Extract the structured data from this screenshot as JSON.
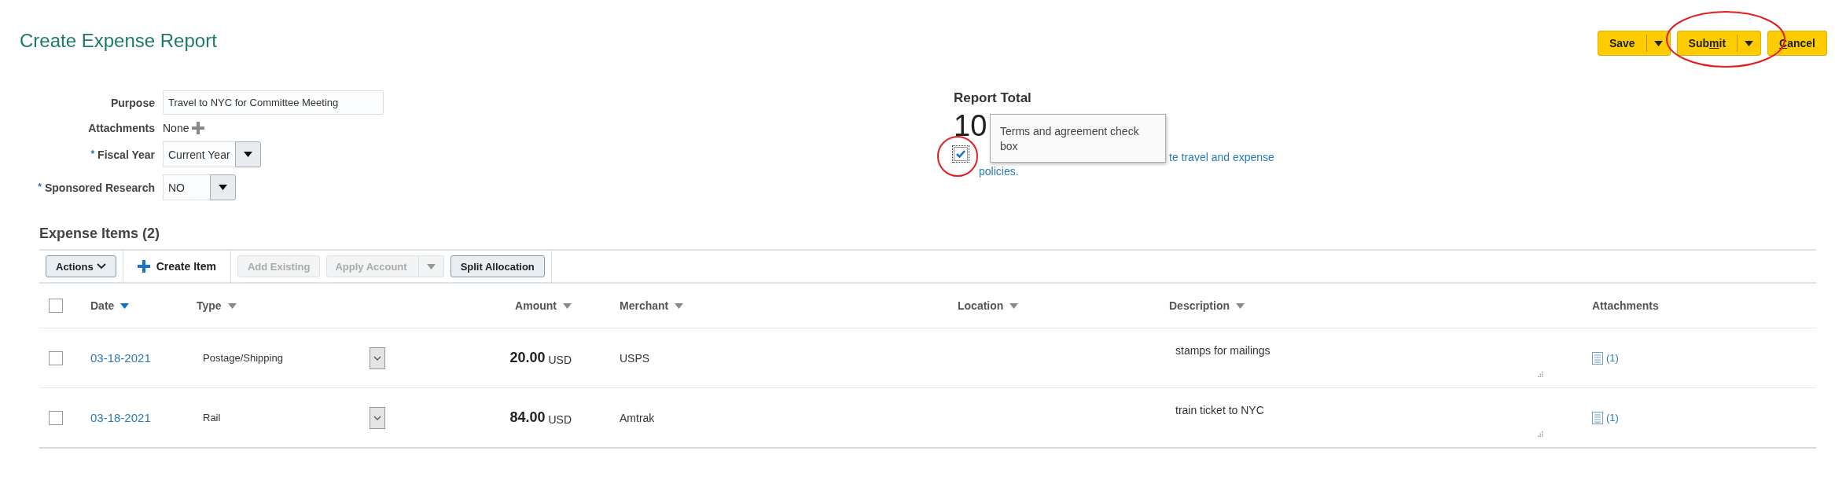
{
  "page": {
    "title": "Create Expense Report"
  },
  "header_buttons": [
    {
      "label_parts": [
        {
          "text": "Save",
          "underline": false
        }
      ],
      "kind": "split"
    },
    {
      "label_parts": [
        {
          "text": "Sub",
          "underline": false
        },
        {
          "text": "m",
          "underline": true
        },
        {
          "text": "it",
          "underline": false
        }
      ],
      "kind": "split"
    },
    {
      "label_parts": [
        {
          "text": "C",
          "underline": true
        },
        {
          "text": "ancel",
          "underline": false
        }
      ],
      "kind": "plain"
    }
  ],
  "form": [
    {
      "label": "Purpose",
      "kind": "text",
      "value": "Travel to NYC for Committee Meeting"
    },
    {
      "label": "Attachments",
      "kind": "attach",
      "value": "None"
    },
    {
      "marker": "*",
      "label": "Fiscal Year",
      "kind": "select",
      "value": "Current Year"
    },
    {
      "marker": "*",
      "label": "Sponsored Research",
      "kind": "select",
      "value": "NO"
    }
  ],
  "report_total": {
    "label": "Report Total",
    "amount": "10"
  },
  "tooltip": {
    "text": "Terms and agreement check box"
  },
  "agreement": {
    "checked": true,
    "text": "te travel and expense policies."
  },
  "expense_items": {
    "title": "Expense Items (2)",
    "toolbar": [
      {
        "kind": "menu",
        "label": "Actions",
        "disabled": false
      },
      {
        "kind": "create",
        "label": "Create Item",
        "disabled": false
      },
      {
        "kind": "button",
        "label": "Add Existing",
        "disabled": true
      },
      {
        "kind": "split",
        "label": "Apply Account",
        "disabled": true
      },
      {
        "kind": "button",
        "label": "Split Allocation",
        "disabled": false
      }
    ],
    "select_all": false,
    "columns": [
      {
        "label": "Date",
        "sorted": true
      },
      {
        "label": "Type",
        "sorted": false
      },
      {
        "label": "Amount",
        "sorted": false
      },
      {
        "label": "Merchant",
        "sorted": false
      },
      {
        "label": "Location",
        "sorted": false
      },
      {
        "label": "Description",
        "sorted": false
      },
      {
        "label": "Attachments"
      }
    ],
    "rows": [
      {
        "selected": false,
        "date": "03-18-2021",
        "type": "Postage/Shipping",
        "amount": "20.00",
        "currency": "USD",
        "merchant": "USPS",
        "description": "stamps for mailings",
        "attachments": "(1)"
      },
      {
        "selected": false,
        "date": "03-18-2021",
        "type": "Rail",
        "amount": "84.00",
        "currency": "USD",
        "merchant": "Amtrak",
        "description": "train ticket to NYC",
        "attachments": "(1)"
      }
    ]
  }
}
